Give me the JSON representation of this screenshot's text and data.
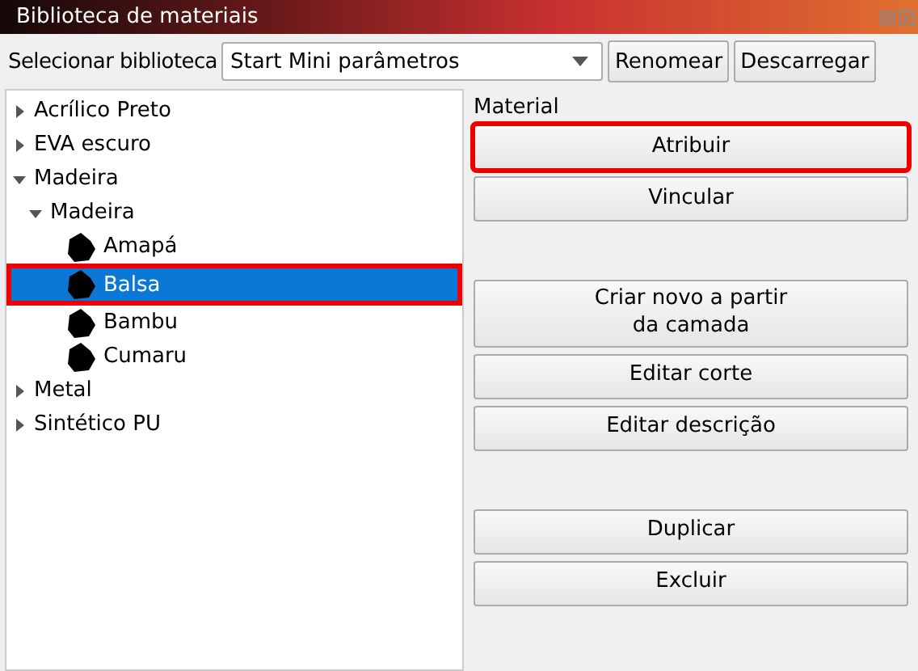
{
  "window": {
    "title": "Biblioteca de materiais"
  },
  "toolbar": {
    "label": "Selecionar biblioteca",
    "library_dropdown": {
      "value": "Start Mini parâmetros"
    },
    "buttons": [
      "Renomear",
      "Descarregar"
    ]
  },
  "tree": [
    {
      "label": "Acrílico Preto",
      "expanded": false,
      "selected": false,
      "highlighted": false
    },
    {
      "label": "EVA escuro",
      "expanded": false,
      "selected": false,
      "highlighted": false
    },
    {
      "label": "Madeira",
      "expanded": true,
      "selected": false,
      "highlighted": false,
      "children": [
        {
          "label": "Madeira",
          "expanded": true,
          "selected": false,
          "highlighted": false,
          "children": [
            {
              "label": "Amapá",
              "kind": "material",
              "selected": false,
              "highlighted": false
            },
            {
              "label": "Balsa",
              "kind": "material",
              "selected": true,
              "highlighted": true
            },
            {
              "label": "Bambu",
              "kind": "material",
              "selected": false,
              "highlighted": false
            },
            {
              "label": "Cumaru",
              "kind": "material",
              "selected": false,
              "highlighted": false
            }
          ]
        }
      ]
    },
    {
      "label": "Metal",
      "expanded": false,
      "selected": false,
      "highlighted": false
    },
    {
      "label": "Sintético PU",
      "expanded": false,
      "selected": false,
      "highlighted": false
    }
  ],
  "material_panel": {
    "title": "Material",
    "button_groups": [
      [
        {
          "label": "Atribuir",
          "highlighted": true
        },
        {
          "label": "Vincular",
          "highlighted": false
        }
      ],
      [
        {
          "label": "Criar novo a partir\nda camada",
          "highlighted": false
        },
        {
          "label": "Editar corte",
          "highlighted": false
        },
        {
          "label": "Editar descrição",
          "highlighted": false
        }
      ],
      [
        {
          "label": "Duplicar",
          "highlighted": false
        },
        {
          "label": "Excluir",
          "highlighted": false
        }
      ]
    ]
  }
}
